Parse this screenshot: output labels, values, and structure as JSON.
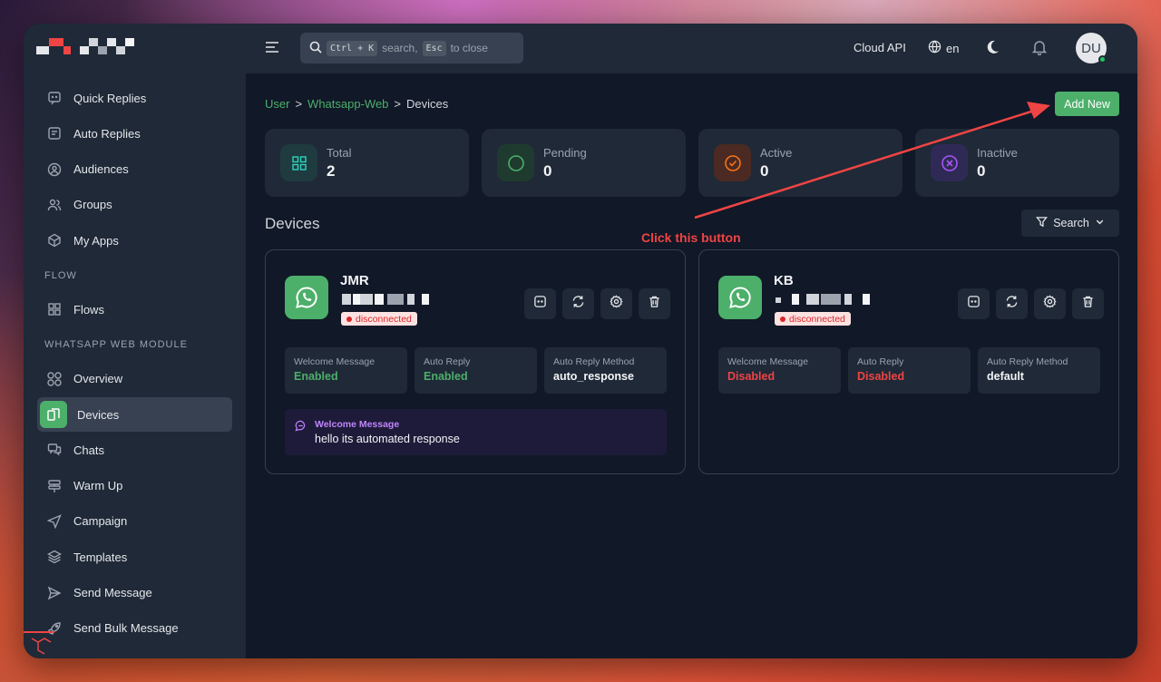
{
  "nav": {
    "items_top": [
      {
        "label": "Quick Replies",
        "icon": "message-square-icon"
      },
      {
        "label": "Auto Replies",
        "icon": "message-text-icon"
      },
      {
        "label": "Audiences",
        "icon": "user-circle-icon"
      },
      {
        "label": "Groups",
        "icon": "users-icon"
      },
      {
        "label": "My Apps",
        "icon": "cube-icon"
      }
    ],
    "section_flow": "FLOW",
    "flow_items": [
      {
        "label": "Flows",
        "icon": "grid-icon"
      }
    ],
    "section_wa": "WHATSAPP WEB MODULE",
    "wa_items": [
      {
        "label": "Overview",
        "icon": "grid-circles-icon"
      },
      {
        "label": "Devices",
        "icon": "device-icon"
      },
      {
        "label": "Chats",
        "icon": "chat-icon"
      },
      {
        "label": "Warm Up",
        "icon": "flame-stack-icon"
      },
      {
        "label": "Campaign",
        "icon": "send-arrow-icon"
      },
      {
        "label": "Templates",
        "icon": "layers-icon"
      },
      {
        "label": "Send Message",
        "icon": "paper-plane-icon"
      },
      {
        "label": "Send Bulk Message",
        "icon": "rocket-icon"
      }
    ]
  },
  "topbar": {
    "search_prefix_kbd": "Ctrl + K",
    "search_text": "search,",
    "search_kbd2": "Esc",
    "search_suffix": "to close",
    "cloud_api": "Cloud API",
    "language": "en",
    "avatar_initials": "DU"
  },
  "breadcrumb": {
    "user": "User",
    "whatsapp": "Whatsapp-Web",
    "current": "Devices",
    "sep": ">"
  },
  "add_new_label": "Add New",
  "stats": [
    {
      "label": "Total",
      "value": "2",
      "color": "#2dd4bf",
      "bg": "#1f3b3f"
    },
    {
      "label": "Pending",
      "value": "0",
      "color": "#4caf6a",
      "bg": "#1f3b2f"
    },
    {
      "label": "Active",
      "value": "0",
      "color": "#f97316",
      "bg": "#4a2a22"
    },
    {
      "label": "Inactive",
      "value": "0",
      "color": "#a855f7",
      "bg": "#2f2a55"
    }
  ],
  "devices_heading": "Devices",
  "annotation": "Click this button",
  "search_btn_label": "Search",
  "devices": [
    {
      "name": "JMR",
      "status": "disconnected",
      "welcome_label": "Welcome Message",
      "welcome_value": "Enabled",
      "auto_reply_label": "Auto Reply",
      "auto_reply_value": "Enabled",
      "method_label": "Auto Reply Method",
      "method_value": "auto_response",
      "message_label": "Welcome Message",
      "message_text": "hello its automated response"
    },
    {
      "name": "KB",
      "status": "disconnected",
      "welcome_label": "Welcome Message",
      "welcome_value": "Disabled",
      "auto_reply_label": "Auto Reply",
      "auto_reply_value": "Disabled",
      "method_label": "Auto Reply Method",
      "method_value": "default"
    }
  ],
  "colors": {
    "accent": "#4caf6a",
    "enabled": "#4caf6a",
    "disabled": "#ef4444",
    "annotation": "#ef4444"
  }
}
